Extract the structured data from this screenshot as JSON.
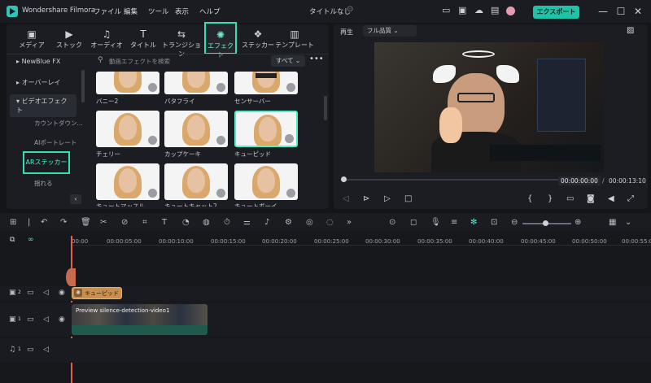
{
  "titlebar": {
    "app_name": "Wondershare Filmora",
    "menus": [
      "ファイル",
      "編集",
      "ツール",
      "表示",
      "ヘルプ"
    ],
    "project_title": "タイトルなし",
    "export_label": "エクスポート ⌄"
  },
  "tabs": [
    {
      "label": "メディア",
      "icon": "media-icon"
    },
    {
      "label": "ストック",
      "icon": "stock-icon"
    },
    {
      "label": "オーディオ",
      "icon": "audio-icon"
    },
    {
      "label": "タイトル",
      "icon": "title-icon"
    },
    {
      "label": "トランジション",
      "icon": "transition-icon"
    },
    {
      "label": "エフェクト",
      "icon": "effects-icon",
      "active": true
    },
    {
      "label": "ステッカー",
      "icon": "sticker-icon"
    },
    {
      "label": "テンプレート",
      "icon": "template-icon"
    }
  ],
  "sidebar": {
    "items": [
      "NewBlue FX",
      "オーバーレイ",
      "ビデオエフェクト"
    ],
    "subitems": [
      "カウントダウン...",
      "AIポートレート",
      "ARステッカー",
      "揺れる"
    ]
  },
  "search": {
    "placeholder": "動画エフェクトを検索",
    "filter": "すべて ⌄"
  },
  "effects": [
    {
      "label": "バニー2"
    },
    {
      "label": "バタフライ"
    },
    {
      "label": "センサーバー"
    },
    {
      "label": "チェリー"
    },
    {
      "label": "カップケーキ"
    },
    {
      "label": "キューピッド"
    },
    {
      "label": "キュートマッスル"
    },
    {
      "label": "キュートキャット2"
    },
    {
      "label": "キュートボーイ"
    }
  ],
  "preview": {
    "mode": "再生",
    "quality": "フル品質 ⌄",
    "current_time": "00:00:00:00",
    "separator": "/",
    "total_time": "00:00:13:10"
  },
  "timeline": {
    "ruler": [
      "00:00",
      "00:00:05:00",
      "00:00:10:00",
      "00:00:15:00",
      "00:00:20:00",
      "00:00:25:00",
      "00:00:30:00",
      "00:00:35:00",
      "00:00:40:00",
      "00:00:45:00",
      "00:00:50:00",
      "00:00:55:00"
    ],
    "effect_clip": "キューピッド",
    "video_clip": "Preview silence-detection-video1",
    "tracks": [
      "2",
      "1",
      "1"
    ]
  }
}
